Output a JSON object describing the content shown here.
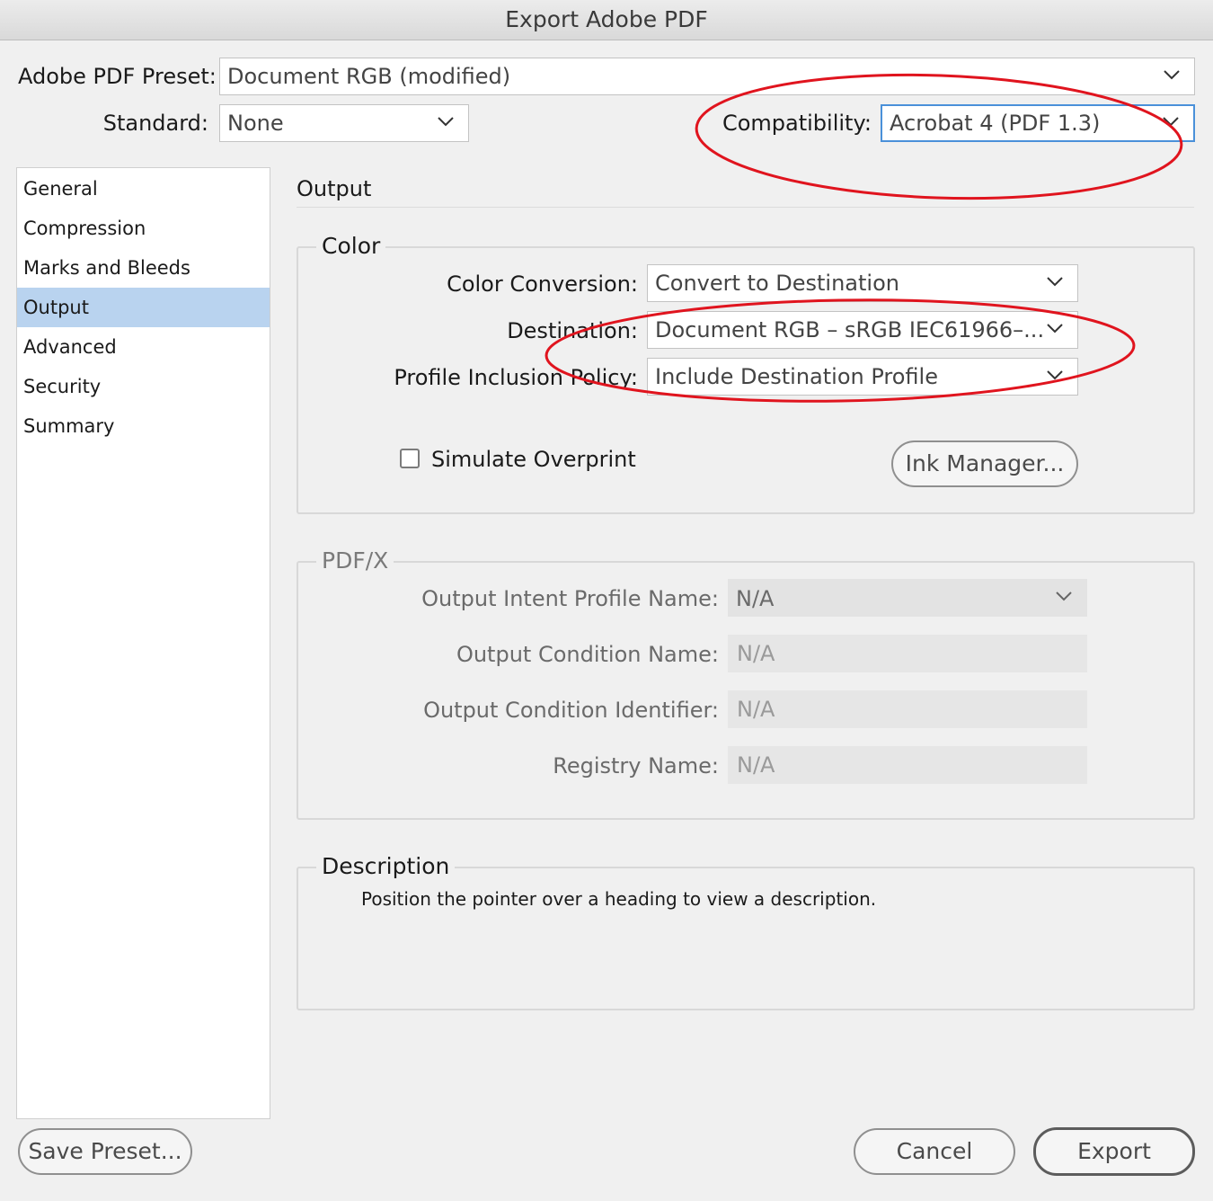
{
  "window": {
    "title": "Export Adobe PDF"
  },
  "preset": {
    "label": "Adobe PDF Preset:",
    "value": "Document RGB (modified)"
  },
  "standard": {
    "label": "Standard:",
    "value": "None"
  },
  "compatibility": {
    "label": "Compatibility:",
    "value": "Acrobat 4 (PDF 1.3)"
  },
  "sidebar": {
    "items": [
      {
        "label": "General"
      },
      {
        "label": "Compression"
      },
      {
        "label": "Marks and Bleeds"
      },
      {
        "label": "Output",
        "selected": true
      },
      {
        "label": "Advanced"
      },
      {
        "label": "Security"
      },
      {
        "label": "Summary"
      }
    ]
  },
  "pane": {
    "title": "Output",
    "color": {
      "legend": "Color",
      "conversion": {
        "label": "Color Conversion:",
        "value": "Convert to Destination"
      },
      "destination": {
        "label": "Destination:",
        "value": "Document RGB – sRGB IEC61966–..."
      },
      "profile_policy": {
        "label": "Profile Inclusion Policy:",
        "value": "Include Destination Profile"
      },
      "simulate_overprint": {
        "label": "Simulate Overprint",
        "checked": false
      },
      "ink_manager": "Ink Manager..."
    },
    "pdfx": {
      "legend": "PDF/X",
      "output_intent": {
        "label": "Output Intent Profile Name:",
        "value": "N/A"
      },
      "condition_name": {
        "label": "Output Condition Name:",
        "value": "N/A"
      },
      "condition_identifier": {
        "label": "Output Condition Identifier:",
        "value": "N/A"
      },
      "registry_name": {
        "label": "Registry Name:",
        "value": "N/A"
      }
    },
    "description": {
      "legend": "Description",
      "text": "Position the pointer over a heading to view a description."
    }
  },
  "footer": {
    "save_preset": "Save Preset...",
    "cancel": "Cancel",
    "export": "Export"
  },
  "colors": {
    "selection": "#b9d3ef",
    "focus": "#4a90d9",
    "annotation": "#e0141e"
  }
}
